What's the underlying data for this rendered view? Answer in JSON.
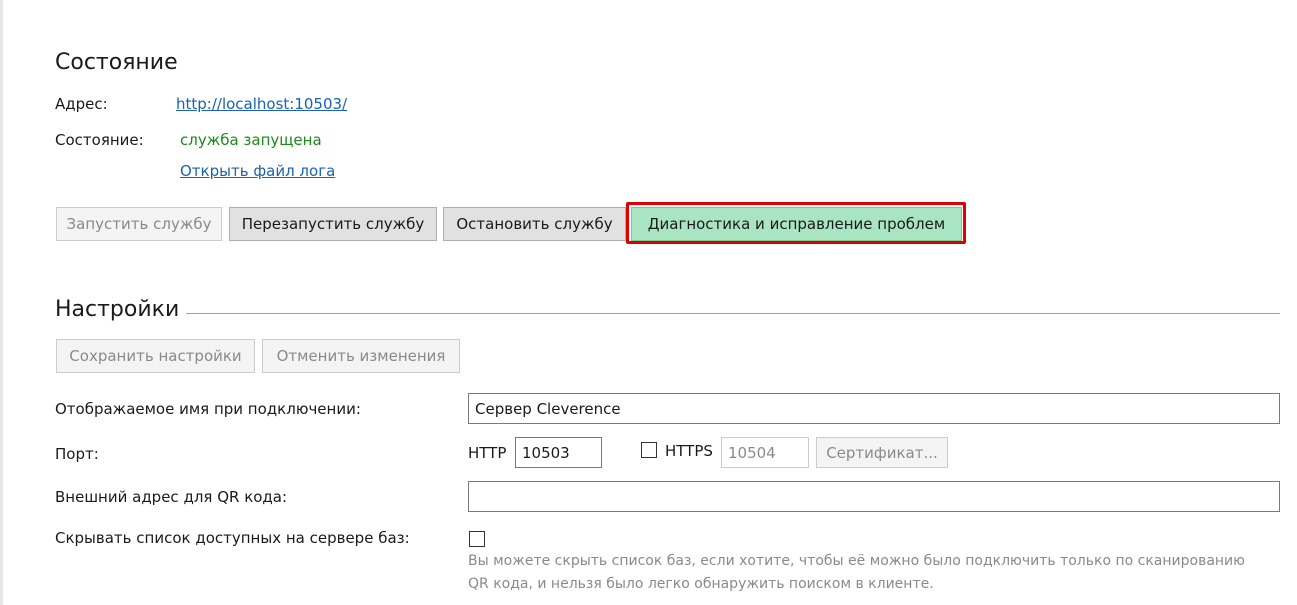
{
  "status_section": {
    "title": "Состояние",
    "address_label": "Адрес:",
    "address_link": " http://localhost:10503/",
    "state_label": "Состояние:",
    "state_value": "служба запущена",
    "state_color": "#1d8a1d",
    "open_log_link": "Открыть файл лога",
    "buttons": {
      "start": "Запустить службу",
      "restart": "Перезапустить службу",
      "stop": "Остановить службу",
      "diagnose": "Диагностика и исправление проблем"
    }
  },
  "settings_section": {
    "title": "Настройки",
    "save_button": "Сохранить настройки",
    "cancel_button": "Отменить изменения",
    "display_name_label": "Отображаемое имя при подключении:",
    "display_name_value": "Сервер Cleverence",
    "port_label": "Порт:",
    "http_label": "HTTP",
    "http_port_value": "10503",
    "https_label": "HTTPS",
    "https_checked": false,
    "https_port_value": "10504",
    "certificate_button": "Сертификат...",
    "qr_address_label": "Внешний адрес для QR кода:",
    "qr_address_value": "",
    "hide_db_list_label": "Скрывать список доступных на сервере баз:",
    "hide_db_list_checked": false,
    "hide_db_list_hint_line1": "Вы можете скрыть список баз, если хотите, чтобы её можно было подключить только по сканированию",
    "hide_db_list_hint_line2": "QR кода, и нельзя было легко обнаружить поиском в клиенте."
  },
  "colors": {
    "accent_button": "#a9e4c3",
    "highlight_border": "#e00000",
    "link": "#1a62b4"
  }
}
